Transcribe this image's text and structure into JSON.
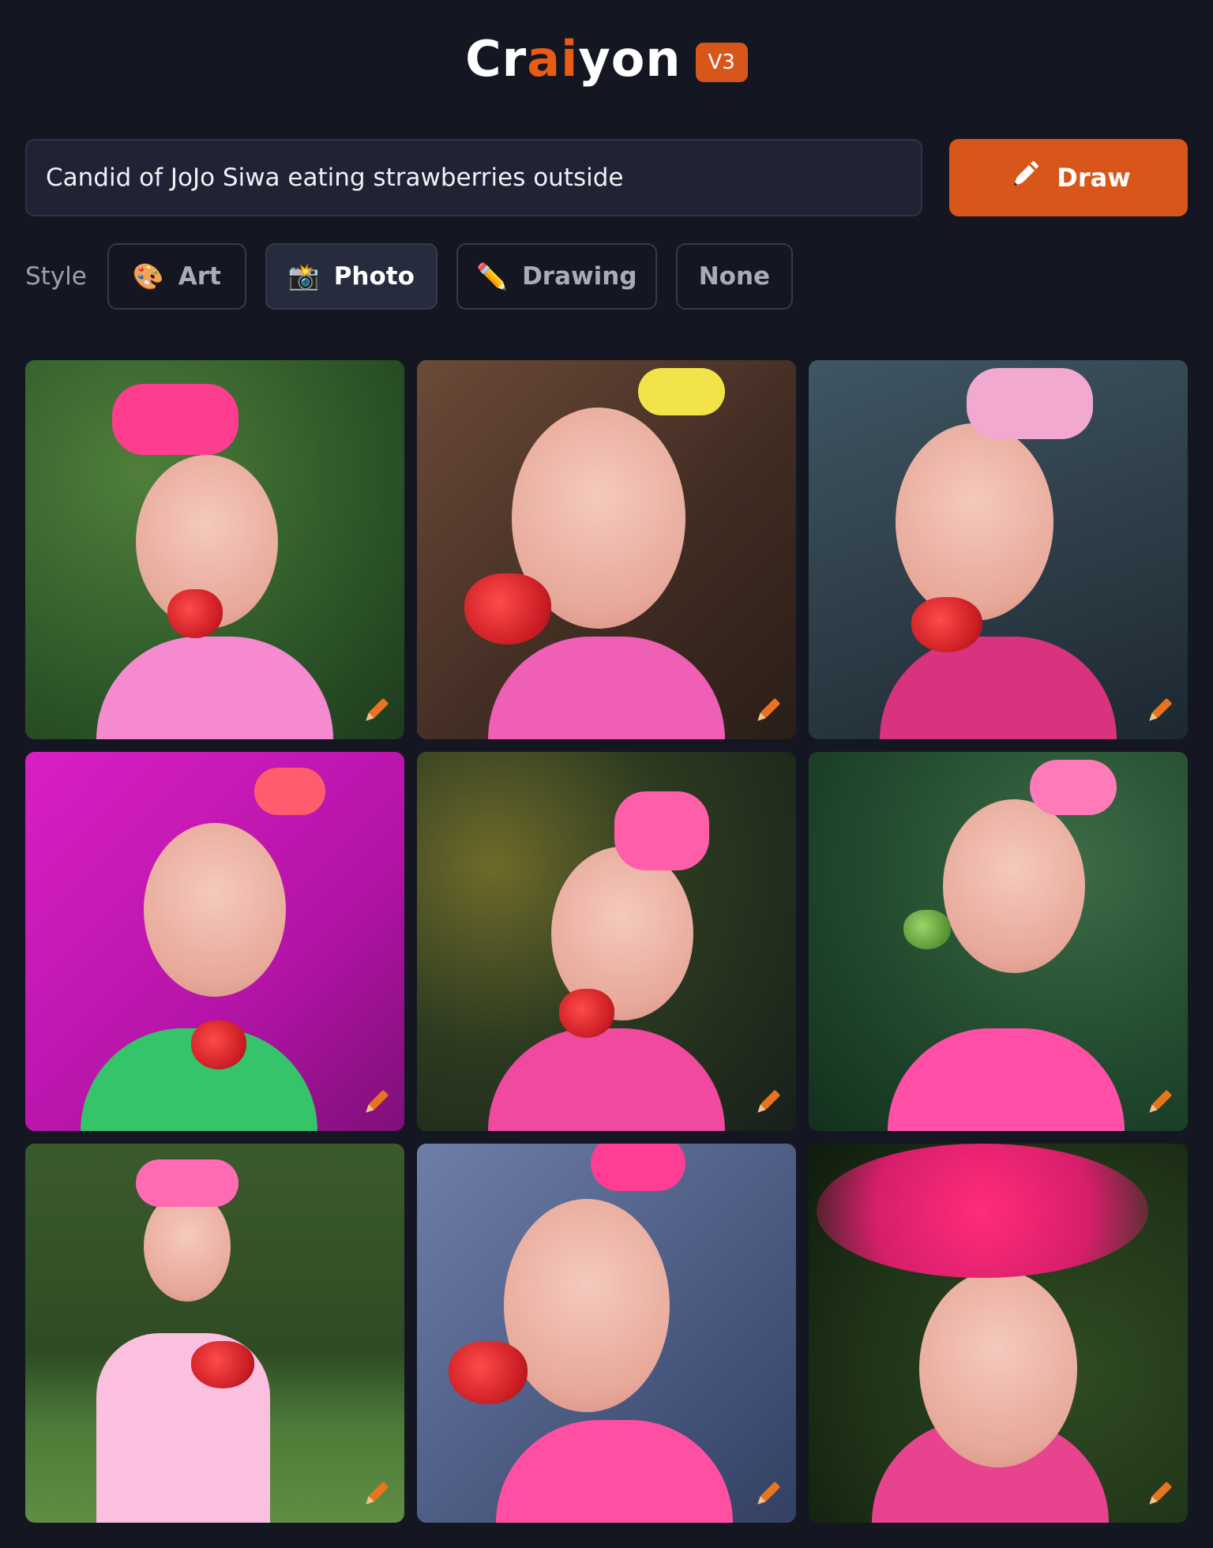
{
  "logo": {
    "part1": "Cr",
    "part2": "ai",
    "part3": "yon",
    "version": "V3"
  },
  "prompt": {
    "value": "Candid of JoJo Siwa eating strawberries outside"
  },
  "draw_button": {
    "label": "Draw",
    "icon": "pencil-icon"
  },
  "style": {
    "label": "Style",
    "options": [
      {
        "label": "Art",
        "emoji": "🎨",
        "active": false
      },
      {
        "label": "Photo",
        "emoji": "📸",
        "active": true
      },
      {
        "label": "Drawing",
        "emoji": "✏️",
        "active": false
      },
      {
        "label": "None",
        "emoji": "",
        "active": false
      }
    ]
  },
  "colors": {
    "background": "#141722",
    "accent": "#d9561a",
    "input_bg": "#1f2334"
  },
  "images": [
    {
      "bg": "forest-green",
      "bow": "#ff3d8f",
      "shirt": "#f58ad0",
      "description": "generated image 1"
    },
    {
      "bg": "brown-wood",
      "bow": "#f3e34a",
      "shirt": "#ee5fb5",
      "description": "generated image 2"
    },
    {
      "bg": "slate",
      "bow": "#f1a9cf",
      "shirt": "#d9337f",
      "description": "generated image 3"
    },
    {
      "bg": "magenta",
      "bow": "#ff5c6d",
      "shirt": "#35c46a",
      "description": "generated image 4"
    },
    {
      "bg": "dark-bokeh",
      "bow": "#ff5fa8",
      "shirt": "#ef4aa0",
      "description": "generated image 5"
    },
    {
      "bg": "leaf-green",
      "bow": "#ff7ab8",
      "shirt": "#ff4fa6",
      "description": "generated image 6"
    },
    {
      "bg": "park",
      "bow": "#ff6bb3",
      "shirt": "#fbbfe0",
      "description": "generated image 7"
    },
    {
      "bg": "blur-blue",
      "bow": "#ff3d92",
      "shirt": "#ff4fa3",
      "description": "generated image 8"
    },
    {
      "bg": "deep-green",
      "bow": "#ff2c7a",
      "shirt": "#e8438f",
      "description": "generated image 9"
    }
  ]
}
